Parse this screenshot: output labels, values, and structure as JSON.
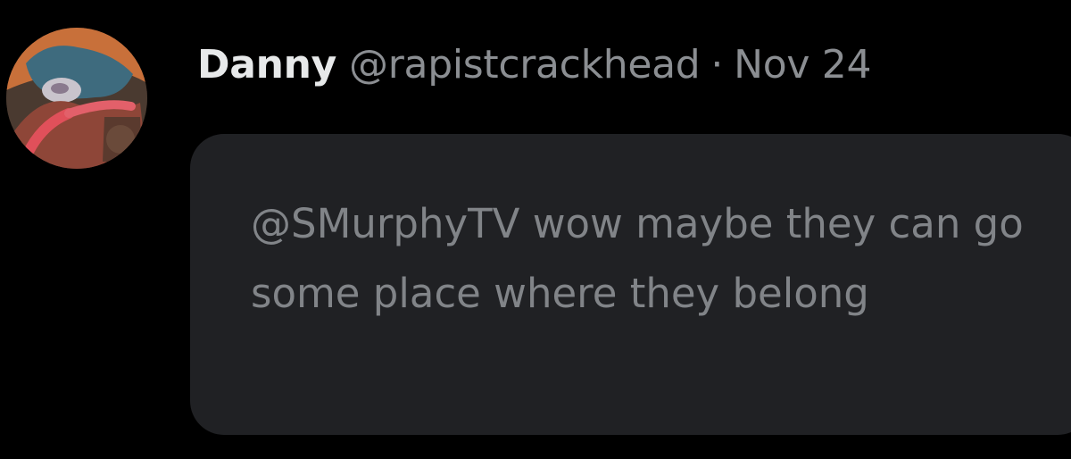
{
  "author": {
    "display_name": "Danny",
    "handle": "@rapistcrackhead",
    "separator": "·",
    "date": "Nov 24",
    "avatar_icon": "cartoon-character-avatar"
  },
  "message": {
    "text": "@SMurphyTV wow maybe they can go some place where they belong"
  },
  "colors": {
    "background": "#000000",
    "bubble": "#202124",
    "display_name": "#e7e9ea",
    "muted_text": "#8b8e92",
    "message_text": "#818488"
  }
}
